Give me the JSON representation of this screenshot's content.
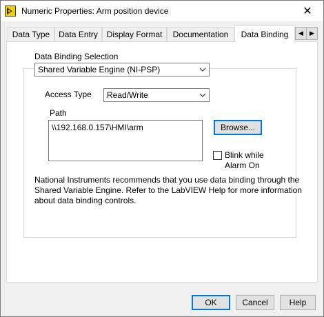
{
  "window": {
    "title": "Numeric Properties: Arm position device",
    "close_glyph": "✕"
  },
  "tabs": [
    {
      "label": "Data Type",
      "active": false
    },
    {
      "label": "Data Entry",
      "active": false
    },
    {
      "label": "Display Format",
      "active": false
    },
    {
      "label": "Documentation",
      "active": false
    },
    {
      "label": "Data Binding",
      "active": true
    }
  ],
  "tab_scroll": {
    "left": "◀",
    "right": "▶"
  },
  "binding": {
    "selection_label": "Data Binding Selection",
    "selection_value": "Shared Variable Engine (NI-PSP)",
    "access_label": "Access Type",
    "access_value": "Read/Write",
    "path_label": "Path",
    "path_value": "\\\\192.168.0.157\\HMI\\arm",
    "browse_label": "Browse...",
    "blink_label_line1": "Blink while",
    "blink_label_line2": "Alarm On",
    "blink_checked": false,
    "info_lines": [
      "National Instruments recommends that you use data binding through the",
      "Shared Variable Engine.  Refer to the LabVIEW Help for more information",
      "about data binding controls."
    ]
  },
  "footer": {
    "ok_label": "OK",
    "cancel_label": "Cancel",
    "help_label": "Help"
  },
  "colors": {
    "accent": "#0078d7",
    "panel_bg": "#ffffff",
    "dialog_bg": "#f0f0f0"
  }
}
